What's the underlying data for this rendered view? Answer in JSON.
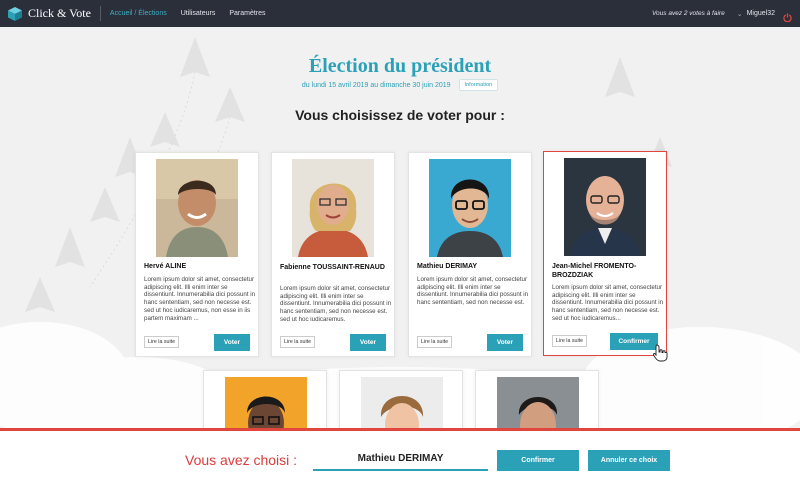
{
  "app": {
    "name": "Click & Vote"
  },
  "nav": [
    {
      "label": "Accueil / Élections",
      "active": true
    },
    {
      "label": "Utilisateurs",
      "active": false
    },
    {
      "label": "Paramètres",
      "active": false
    }
  ],
  "user": {
    "votes_left": "Vous avez 2 votes à faire",
    "name": "Miguel32"
  },
  "election": {
    "title": "Élection du président",
    "dates": "du lundi 15 avril 2019 au dimanche 30 juin 2019",
    "info_button": "Information",
    "prompt": "Vous choisissez de voter pour :"
  },
  "candidates": [
    {
      "name": "Hervé ALINE",
      "description": "Lorem ipsum dolor sit amet, consectetur adipiscing elit. Illi enim inter se dissentiunt. Innumerabilia dici possunt in hanc sententiam, sed non necesse est. sed ut hoc iudicaremus, non esse in iis partem maximam ...",
      "read_more": "Lire la suite",
      "action": "Voter"
    },
    {
      "name": "Fabienne TOUSSAINT-RENAUD",
      "description": "Lorem ipsum dolor sit amet, consectetur adipiscing elit. Illi enim inter se dissentiunt. Innumerabilia dici possunt in hanc sententiam, sed non necesse est. sed ut hoc iudicaremus.",
      "read_more": "Lire la suite",
      "action": "Voter"
    },
    {
      "name": "Mathieu DERIMAY",
      "description": "Lorem ipsum dolor sit amet, consectetur adipiscing elit. Illi enim inter se dissentiunt. Innumerabilia dici possunt in hanc sententiam, sed non necesse est.",
      "read_more": "Lire la suite",
      "action": "Voter"
    },
    {
      "name": "Jean-Michel FROMENTO-BROZDZIAK",
      "description": "Lorem ipsum dolor sit amet, consectetur adipiscing elit. Illi enim inter se dissentiunt. Innumerabilia dici possunt in hanc sententiam, sed non necesse est. sed ut hoc iudicaremus...",
      "read_more": "Lire la suite",
      "action": "Confirmer",
      "selected": true
    }
  ],
  "selection": {
    "label": "Vous avez choisi :",
    "value": "Mathieu DERIMAY",
    "confirm": "Confirmer",
    "cancel": "Annuler ce choix"
  },
  "colors": {
    "accent": "#2ba1b8",
    "alert": "#e0453e",
    "topbar": "#2b2f3a"
  },
  "icons": {
    "logo": "cube-logo-icon",
    "user_menu": "chevron-down-icon",
    "logout": "power-icon",
    "cursor": "hand-pointer-icon"
  }
}
